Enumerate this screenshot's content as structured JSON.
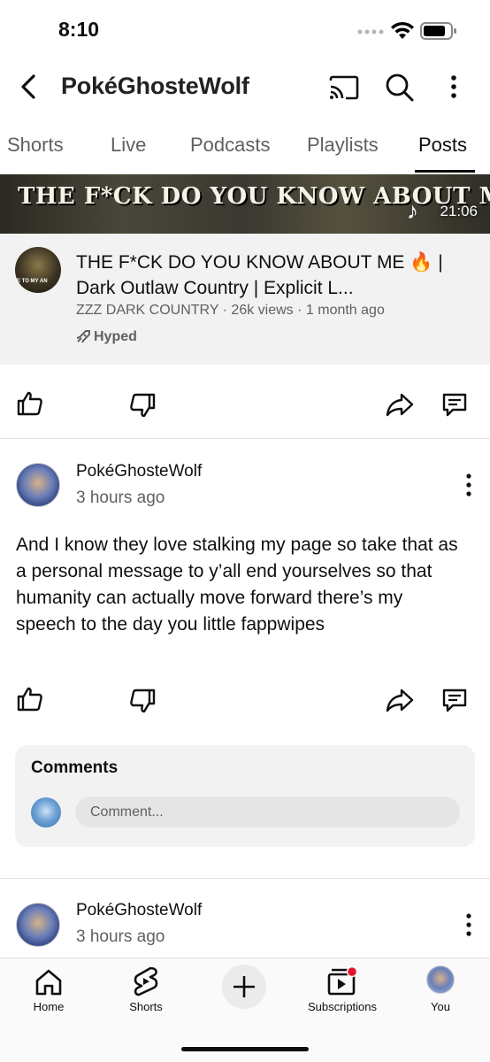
{
  "status_bar": {
    "time": "8:10"
  },
  "header": {
    "channel_name": "PokéGhosteWolf"
  },
  "tabs": [
    {
      "label": "Shorts"
    },
    {
      "label": "Live"
    },
    {
      "label": "Podcasts"
    },
    {
      "label": "Playlists"
    },
    {
      "label": "Posts",
      "active": true
    }
  ],
  "video_post": {
    "banner_text": "THE F*CK DO YOU KNOW ABOUT ME",
    "duration": "21:06",
    "thumb_text": "E TO MY AN",
    "title": "THE F*CK DO YOU KNOW ABOUT ME 🔥 | Dark Outlaw Country | Explicit L...",
    "channel": "ZZZ DARK COUNTRY",
    "views": "26k views",
    "age": "1 month ago",
    "badge": "Hyped"
  },
  "posts": [
    {
      "author": "PokéGhosteWolf",
      "time": "3 hours ago",
      "avatar_text": "PokéGhostWolf",
      "text": "And I know they love stalking my page so take that as a personal message to y’all end yourselves so that humanity can actually move forward there’s my speech to the day you little fappwipes"
    },
    {
      "author": "PokéGhosteWolf",
      "time": "3 hours ago",
      "avatar_text": "PokéGhostWolf"
    }
  ],
  "comments": {
    "title": "Comments",
    "placeholder": "Comment..."
  },
  "bottom_nav": [
    {
      "label": "Home",
      "icon": "home-icon"
    },
    {
      "label": "Shorts",
      "icon": "shorts-icon"
    },
    {
      "label": "",
      "icon": "create-plus-icon"
    },
    {
      "label": "Subscriptions",
      "icon": "subscriptions-icon"
    },
    {
      "label": "You",
      "icon": "avatar"
    }
  ],
  "colors": {
    "text": "#0f0f0f",
    "secondary": "#606060",
    "panel": "#f2f2f2",
    "notification_dot": "#e3122b"
  }
}
